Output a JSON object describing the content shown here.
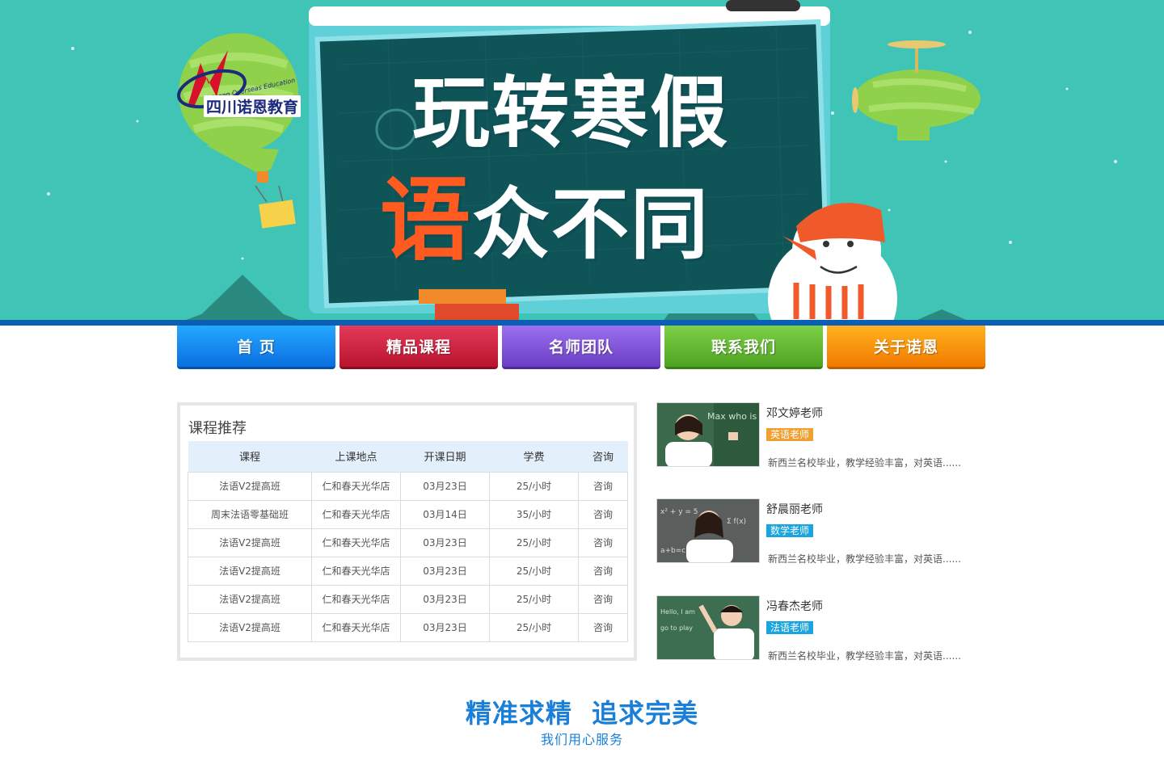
{
  "banner": {
    "title_line1": "玩转寒假",
    "title_line2_accent": "语",
    "title_line2_rest": "众不同",
    "logo_cn": "四川诺恩教育",
    "logo_en": "Nuoen Overseas Education"
  },
  "nav": {
    "items": [
      {
        "label": "首 页",
        "color": "#1a8ff0"
      },
      {
        "label": "精品课程",
        "color": "#d0223f"
      },
      {
        "label": "名师团队",
        "color": "#8152dc"
      },
      {
        "label": "联系我们",
        "color": "#62b830"
      },
      {
        "label": "关于诺恩",
        "color": "#fb9510"
      }
    ]
  },
  "courses": {
    "title": "课程推荐",
    "headers": [
      "课程",
      "上课地点",
      "开课日期",
      "学费",
      "咨询"
    ],
    "rows": [
      [
        "法语V2提高班",
        "仁和春天光华店",
        "03月23日",
        "25/小时",
        "咨询"
      ],
      [
        "周末法语零基础班",
        "仁和春天光华店",
        "03月14日",
        "35/小时",
        "咨询"
      ],
      [
        "法语V2提高班",
        "仁和春天光华店",
        "03月23日",
        "25/小时",
        "咨询"
      ],
      [
        "法语V2提高班",
        "仁和春天光华店",
        "03月23日",
        "25/小时",
        "咨询"
      ],
      [
        "法语V2提高班",
        "仁和春天光华店",
        "03月23日",
        "25/小时",
        "咨询"
      ],
      [
        "法语V2提高班",
        "仁和春天光华店",
        "03月23日",
        "25/小时",
        "咨询"
      ]
    ]
  },
  "teachers": [
    {
      "name": "邓文婷老师",
      "tag": "英语老师",
      "tag_color": "#f0a030",
      "desc": "新西兰名校毕业，教学经验丰富，对英语......"
    },
    {
      "name": "舒晨丽老师",
      "tag": "数学老师",
      "tag_color": "#1aa5e0",
      "desc": "新西兰名校毕业，教学经验丰富，对英语......"
    },
    {
      "name": "冯春杰老师",
      "tag": "法语老师",
      "tag_color": "#1aa5e0",
      "desc": "新西兰名校毕业，教学经验丰富，对英语......"
    }
  ],
  "slogan": {
    "main": "精准求精  追求完美",
    "sub": "我们用心服务"
  }
}
